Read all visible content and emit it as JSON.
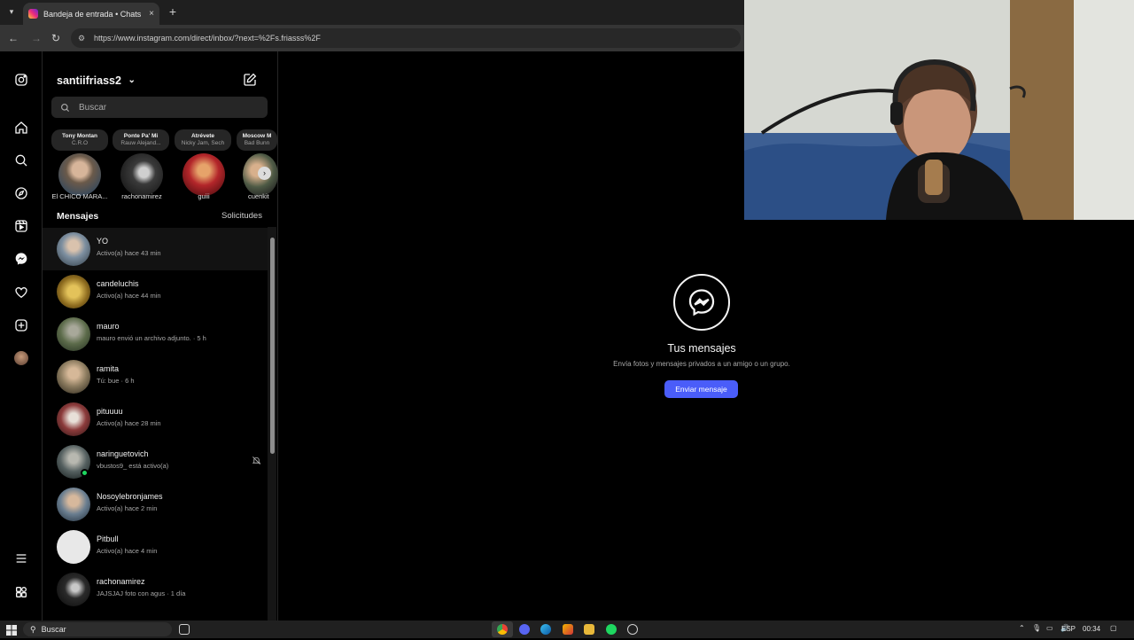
{
  "browser": {
    "tab_title": "Bandeja de entrada • Chats",
    "url": "https://www.instagram.com/direct/inbox/?next=%2Fs.friasss%2F",
    "close_glyph": "×",
    "newtab_glyph": "+"
  },
  "sidebar": {
    "items": [
      "instagram-logo-icon",
      "home-icon",
      "search-icon",
      "explore-icon",
      "reels-icon",
      "messenger-icon",
      "heart-icon",
      "create-icon",
      "profile-icon",
      "menu-icon",
      "threads-icon"
    ]
  },
  "inbox": {
    "account": "santiifriass2",
    "account_chevron": "⌄",
    "search_placeholder": "Buscar",
    "notes": [
      {
        "title": "Tony Montan",
        "sub": "C.R.O"
      },
      {
        "title": "Ponte Pa' Mi",
        "sub": "Rauw Alejand..."
      },
      {
        "title": "Atrévete",
        "sub": "Nicky Jam, Sech"
      },
      {
        "title": "Moscow M",
        "sub": "Bad Bunn"
      }
    ],
    "stories": [
      {
        "label": "El CHICO MARA..."
      },
      {
        "label": "rachonamirez"
      },
      {
        "label": "guiii"
      },
      {
        "label": "cuenkit"
      }
    ],
    "messages_header": "Mensajes",
    "requests_header": "Solicitudes",
    "conversations": [
      {
        "name": "YO",
        "status": "Activo(a) hace 43 min",
        "avatar_color": "#7d8fa0"
      },
      {
        "name": "candeluchis",
        "status": "Activo(a) hace 44 min",
        "avatar_color": "#b59a2a"
      },
      {
        "name": "mauro",
        "status": "mauro envió un archivo adjunto. · 5 h",
        "avatar_color": "#5c6b4a"
      },
      {
        "name": "ramita",
        "status": "Tú: bue · 6 h",
        "avatar_color": "#8a7a5e"
      },
      {
        "name": "pituuuu",
        "status": "Activo(a) hace 28 min",
        "avatar_color": "#8c3b3b"
      },
      {
        "name": "naringuetovich",
        "status": "vbustos9_ está activo(a)",
        "avatar_color": "#556060"
      },
      {
        "name": "Nosoylebronjames",
        "status": "Activo(a) hace 2 min",
        "avatar_color": "#6a7e90"
      },
      {
        "name": "Pitbull",
        "status": "Activo(a) hace 4 min",
        "avatar_color": "#e8e8e8"
      },
      {
        "name": "rachonamirez",
        "status": "JAJSJAJ foto con agus · 1 día",
        "avatar_color": "#2a2a2a"
      }
    ]
  },
  "main": {
    "title": "Tus mensajes",
    "description": "Envía fotos y mensajes privados a un amigo o un grupo.",
    "send_button": "Enviar mensaje"
  },
  "taskbar": {
    "search_label": "Buscar",
    "lang": "ESP",
    "time": "00:34"
  },
  "colors": {
    "accent": "#4a5df9",
    "online": "#1ed760"
  }
}
